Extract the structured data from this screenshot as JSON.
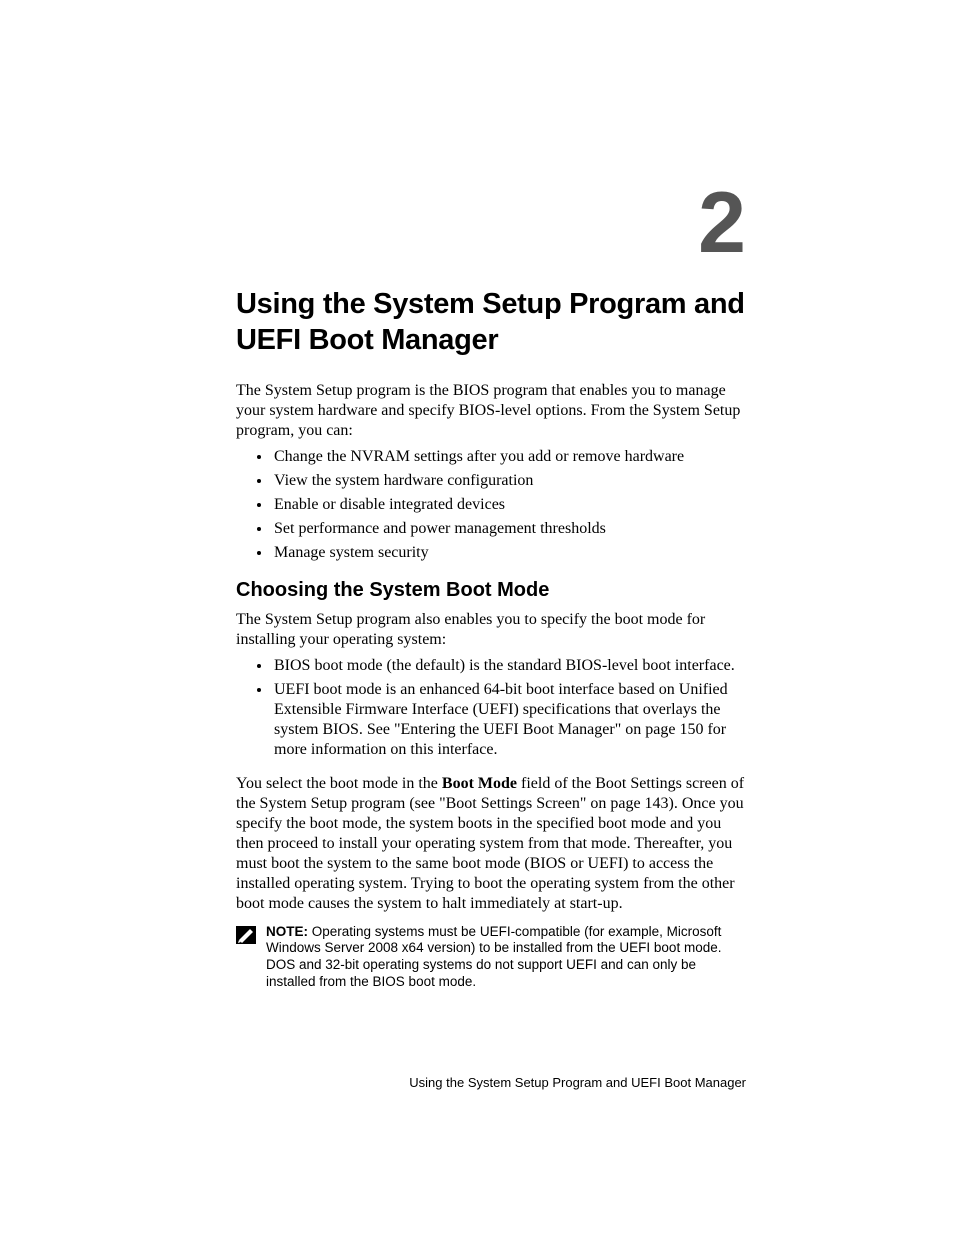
{
  "chapter_number": "2",
  "title": "Using the System Setup Program and UEFI Boot Manager",
  "intro": "The System Setup program is the BIOS program that enables you to manage your system hardware and specify BIOS-level options. From the System Setup program, you can:",
  "intro_bullets": [
    "Change the NVRAM settings after you add or remove hardware",
    "View the system hardware configuration",
    "Enable or disable integrated devices",
    "Set performance and power management thresholds",
    "Manage system security"
  ],
  "section1": {
    "heading": "Choosing the System Boot Mode",
    "para1": "The System Setup program also enables you to specify the boot mode for installing your operating system:",
    "bullets": [
      "BIOS boot mode (the default) is the standard BIOS-level boot interface.",
      "UEFI boot mode is an enhanced 64-bit boot interface based on Unified Extensible Firmware Interface (UEFI) specifications that overlays the system BIOS. See \"Entering the UEFI Boot Manager\" on page 150 for more information on this interface."
    ],
    "para2_pre": "You select the boot mode in the ",
    "para2_bold": "Boot Mode",
    "para2_post": " field of the Boot Settings screen of the System Setup program (see \"Boot Settings Screen\" on page 143). Once you specify the boot mode, the system boots in the specified boot mode and you then proceed to install your operating system from that mode. Thereafter, you must boot the system to the same boot mode (BIOS or UEFI) to access the installed operating system. Trying to boot the operating system from the other boot mode causes the system to halt immediately at start-up."
  },
  "note": {
    "label": "NOTE:",
    "text": " Operating systems must be UEFI-compatible (for example, Microsoft Windows Server 2008 x64 version) to be installed from the UEFI boot mode. DOS and 32-bit operating systems do not support UEFI and can only be installed from the BIOS boot mode."
  },
  "footer_text": "Using the System Setup Program and UEFI Boot Manager"
}
